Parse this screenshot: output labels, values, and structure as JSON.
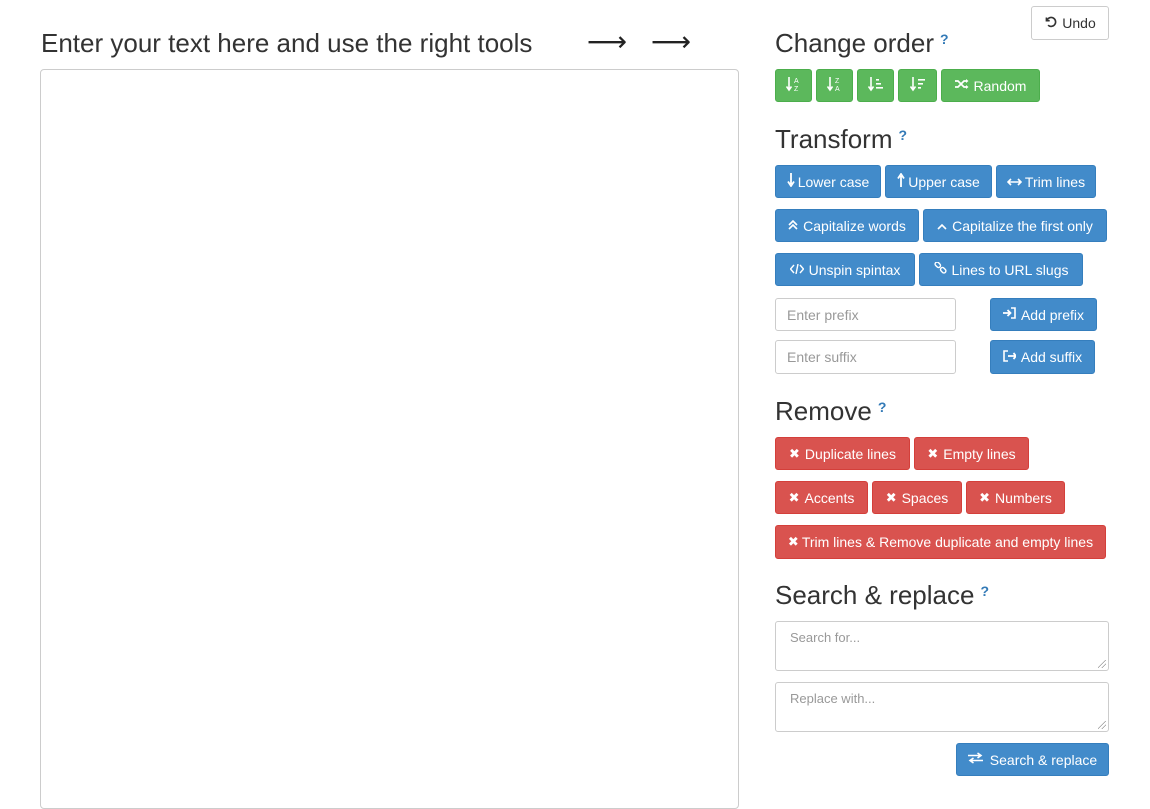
{
  "main": {
    "title": "Enter your text here and use the right tools",
    "arrow1": "⟶",
    "arrow2": "⟶"
  },
  "undo": {
    "label": "Undo",
    "icon": "undo-icon"
  },
  "change_order": {
    "title": "Change order",
    "help": "?",
    "buttons": {
      "sort_az_icon": "sort-alpha-asc-icon",
      "sort_za_icon": "sort-alpha-desc-icon",
      "sort_len_asc_icon": "sort-amount-asc-icon",
      "sort_len_desc_icon": "sort-amount-desc-icon",
      "random_label": "Random",
      "random_icon": "random-icon"
    },
    "color": "#5cb85c"
  },
  "transform": {
    "title": "Transform",
    "help": "?",
    "lower_case": "Lower case",
    "upper_case": "Upper case",
    "trim_lines": "Trim lines",
    "capitalize_words": "Capitalize words",
    "capitalize_first": "Capitalize the first only",
    "unspin_spintax": "Unspin spintax",
    "url_slugs": "Lines to URL slugs",
    "prefix_placeholder": "Enter prefix",
    "add_prefix": "Add prefix",
    "suffix_placeholder": "Enter suffix",
    "add_suffix": "Add suffix",
    "color": "#428bca"
  },
  "remove": {
    "title": "Remove",
    "help": "?",
    "duplicate_lines": "Duplicate lines",
    "empty_lines": "Empty lines",
    "accents": "Accents",
    "spaces": "Spaces",
    "numbers": "Numbers",
    "trim_all": "Trim lines & Remove duplicate and empty lines",
    "color": "#d9534f"
  },
  "search_replace": {
    "title": "Search & replace",
    "help": "?",
    "search_placeholder": "Search for...",
    "replace_placeholder": "Replace with...",
    "button": "Search & replace"
  }
}
